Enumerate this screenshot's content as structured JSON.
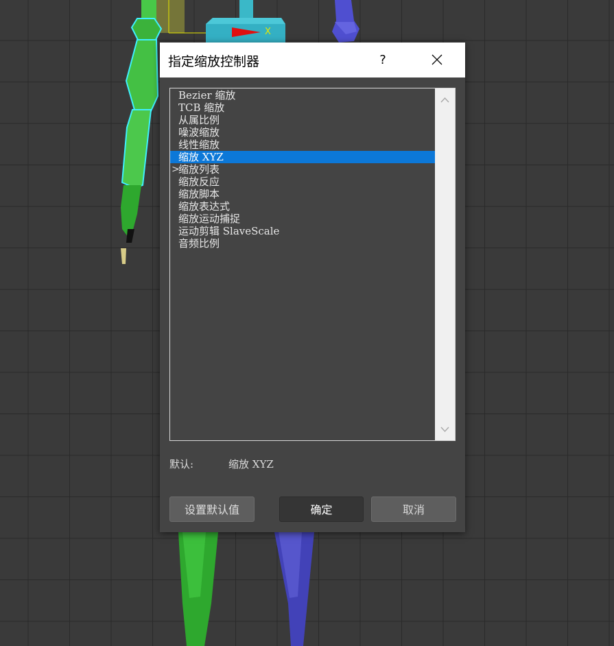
{
  "viewport": {
    "axis_label": "X"
  },
  "dialog": {
    "title": "指定缩放控制器",
    "help_label": "?",
    "list_items": [
      {
        "label": "Bezier 缩放",
        "selected": false,
        "marker": ""
      },
      {
        "label": "TCB 缩放",
        "selected": false,
        "marker": ""
      },
      {
        "label": "从属比例",
        "selected": false,
        "marker": ""
      },
      {
        "label": "噪波缩放",
        "selected": false,
        "marker": ""
      },
      {
        "label": "线性缩放",
        "selected": false,
        "marker": ""
      },
      {
        "label": "缩放 XYZ",
        "selected": true,
        "marker": ""
      },
      {
        "label": "缩放列表",
        "selected": false,
        "marker": ">"
      },
      {
        "label": "缩放反应",
        "selected": false,
        "marker": ""
      },
      {
        "label": "缩放脚本",
        "selected": false,
        "marker": ""
      },
      {
        "label": "缩放表达式",
        "selected": false,
        "marker": ""
      },
      {
        "label": "缩放运动捕捉",
        "selected": false,
        "marker": ""
      },
      {
        "label": "运动剪辑 SlaveScale",
        "selected": false,
        "marker": ""
      },
      {
        "label": "音频比例",
        "selected": false,
        "marker": ""
      }
    ],
    "default_label": "默认:",
    "default_value": "缩放 XYZ",
    "buttons": {
      "set_default": "设置默认值",
      "ok": "确定",
      "cancel": "取消"
    }
  },
  "colors": {
    "selection": "#0c78d8",
    "green_bone": "#3cb53c",
    "blue_bone": "#5050c8",
    "teal_object": "#2fb4c8"
  }
}
